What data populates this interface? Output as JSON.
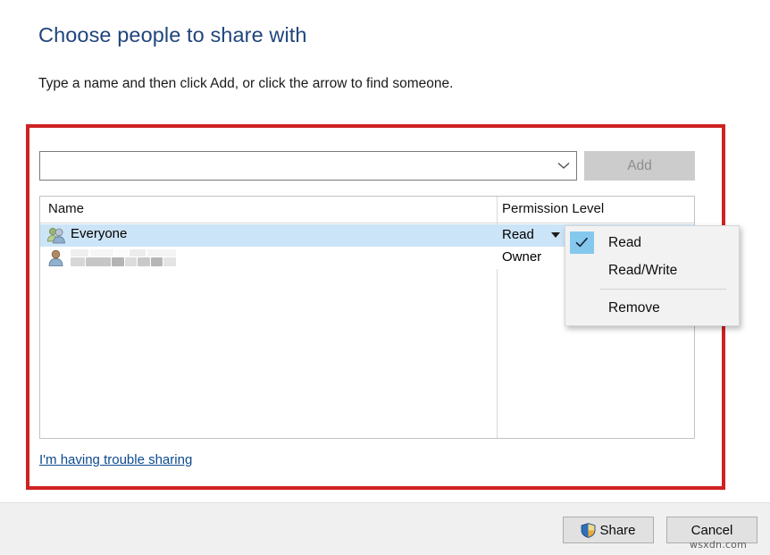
{
  "dialog": {
    "title": "Choose people to share with",
    "subtitle": "Type a name and then click Add, or click the arrow to find someone.",
    "title_color": "#20457c"
  },
  "combobox": {
    "value": "",
    "placeholder": "",
    "arrow_icon": "chevron-down-icon"
  },
  "add_button": {
    "label": "Add",
    "enabled": false
  },
  "list": {
    "columns": [
      "Name",
      "Permission Level"
    ],
    "rows": [
      {
        "icon": "two-users-icon",
        "name": "Everyone",
        "permission": "Read",
        "selected": true,
        "redacted": false,
        "has_caret": true
      },
      {
        "icon": "single-user-icon",
        "name": "",
        "permission": "Owner",
        "selected": false,
        "redacted": true,
        "has_caret": false
      }
    ]
  },
  "permission_menu": {
    "items": [
      {
        "label": "Read",
        "checked": true
      },
      {
        "label": "Read/Write",
        "checked": false
      },
      {
        "label": "Remove",
        "checked": false
      }
    ],
    "check_highlight_color": "#85c8ee"
  },
  "trouble_link": {
    "label": "I'm having trouble sharing"
  },
  "footer": {
    "share_label": "Share",
    "share_icon": "uac-shield-icon",
    "cancel_label": "Cancel"
  },
  "annotation": {
    "highlight_color": "#cf2222"
  },
  "watermark": {
    "text": "wsxdn.com"
  }
}
